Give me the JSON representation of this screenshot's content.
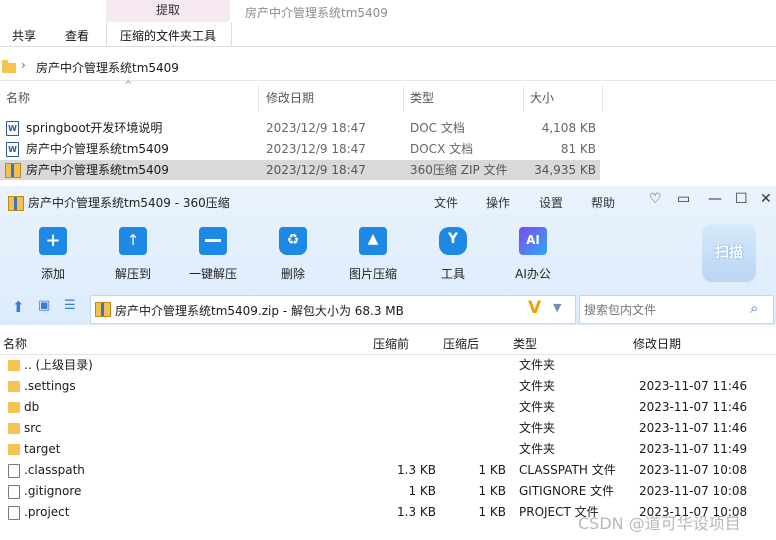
{
  "ribbon": {
    "context_tab": "提取",
    "faded_title": "房产中介管理系统tm5409",
    "tabs": [
      "共享",
      "查看",
      "压缩的文件夹工具"
    ]
  },
  "address": {
    "path": "房产中介管理系统tm5409"
  },
  "explorer": {
    "headers": [
      "名称",
      "修改日期",
      "类型",
      "大小"
    ],
    "rows": [
      {
        "name": "springboot开发环境说明",
        "date": "2023/12/9 18:47",
        "type": "DOC 文档",
        "size": "4,108 KB",
        "icon": "word-doc-icon",
        "selected": false
      },
      {
        "name": "房产中介管理系统tm5409",
        "date": "2023/12/9 18:47",
        "type": "DOCX 文档",
        "size": "81 KB",
        "icon": "word-doc-icon",
        "selected": false
      },
      {
        "name": "房产中介管理系统tm5409",
        "date": "2023/12/9 18:47",
        "type": "360压缩 ZIP 文件",
        "size": "34,935 KB",
        "icon": "zip-icon",
        "selected": true
      }
    ]
  },
  "zipwin": {
    "title": "房产中介管理系统tm5409 - 360压缩",
    "menus": [
      "文件",
      "操作",
      "设置",
      "帮助"
    ],
    "tools": [
      {
        "label": "添加",
        "icon": "add-icon",
        "color": "#1e88e5"
      },
      {
        "label": "解压到",
        "icon": "extract-to-icon",
        "color": "#1e88e5"
      },
      {
        "label": "一键解压",
        "icon": "one-click-extract-icon",
        "color": "#1e88e5"
      },
      {
        "label": "删除",
        "icon": "delete-icon",
        "color": "#1e88e5"
      },
      {
        "label": "图片压缩",
        "icon": "image-compress-icon",
        "color": "#1e88e5"
      },
      {
        "label": "工具",
        "icon": "tools-icon",
        "color": "#1e88e5"
      },
      {
        "label": "AI办公",
        "icon": "ai-office-icon",
        "color": "#5b6cf0"
      }
    ],
    "scan_label": "扫描",
    "path_text": "房产中介管理系统tm5409.zip - 解包大小为 68.3 MB",
    "search_placeholder": "搜索包内文件",
    "headers": [
      "名称",
      "压缩前",
      "压缩后",
      "类型",
      "修改日期"
    ],
    "rows": [
      {
        "name": ".. (上级目录)",
        "before": "",
        "after": "",
        "type": "文件夹",
        "date": "",
        "kind": "folder"
      },
      {
        "name": ".settings",
        "before": "",
        "after": "",
        "type": "文件夹",
        "date": "2023-11-07 11:46",
        "kind": "folder"
      },
      {
        "name": "db",
        "before": "",
        "after": "",
        "type": "文件夹",
        "date": "2023-11-07 11:46",
        "kind": "folder"
      },
      {
        "name": "src",
        "before": "",
        "after": "",
        "type": "文件夹",
        "date": "2023-11-07 11:46",
        "kind": "folder"
      },
      {
        "name": "target",
        "before": "",
        "after": "",
        "type": "文件夹",
        "date": "2023-11-07 11:49",
        "kind": "folder"
      },
      {
        "name": ".classpath",
        "before": "1.3 KB",
        "after": "1 KB",
        "type": "CLASSPATH 文件",
        "date": "2023-11-07 10:08",
        "kind": "file"
      },
      {
        "name": ".gitignore",
        "before": "1 KB",
        "after": "1 KB",
        "type": "GITIGNORE 文件",
        "date": "2023-11-07 10:08",
        "kind": "file"
      },
      {
        "name": ".project",
        "before": "1.3 KB",
        "after": "1 KB",
        "type": "PROJECT 文件",
        "date": "2023-11-07 10:08",
        "kind": "file"
      }
    ]
  },
  "watermark": "CSDN @道可华设项目"
}
